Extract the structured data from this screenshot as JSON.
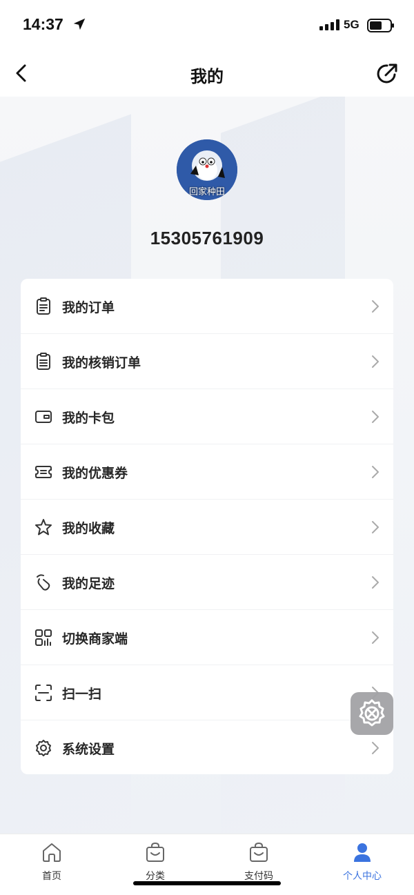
{
  "status_bar": {
    "time": "14:37",
    "network": "5G",
    "battery_level": 0.6
  },
  "nav": {
    "title": "我的",
    "back_icon": "chevron-left-icon",
    "share_icon": "share-icon"
  },
  "profile": {
    "avatar_caption": "回家种田",
    "phone": "15305761909"
  },
  "menu": {
    "items": [
      {
        "label": "我的订单",
        "icon": "order-list-icon"
      },
      {
        "label": "我的核销订单",
        "icon": "verify-order-icon"
      },
      {
        "label": "我的卡包",
        "icon": "wallet-icon"
      },
      {
        "label": "我的优惠券",
        "icon": "coupon-icon"
      },
      {
        "label": "我的收藏",
        "icon": "star-icon"
      },
      {
        "label": "我的足迹",
        "icon": "footprint-icon"
      },
      {
        "label": "切换商家端",
        "icon": "switch-merchant-icon"
      },
      {
        "label": "扫一扫",
        "icon": "scan-icon"
      },
      {
        "label": "系统设置",
        "icon": "settings-icon"
      }
    ]
  },
  "floating": {
    "icon": "tools-icon"
  },
  "tabs": [
    {
      "label": "首页",
      "icon": "home-icon",
      "active": false
    },
    {
      "label": "分类",
      "icon": "bag-icon",
      "active": false
    },
    {
      "label": "支付码",
      "icon": "bag-icon",
      "active": false
    },
    {
      "label": "个人中心",
      "icon": "person-icon",
      "active": true
    }
  ],
  "colors": {
    "accent": "#3b73df",
    "page_bg": "#eef0f5",
    "card_bg": "#ffffff",
    "text": "#262626"
  }
}
